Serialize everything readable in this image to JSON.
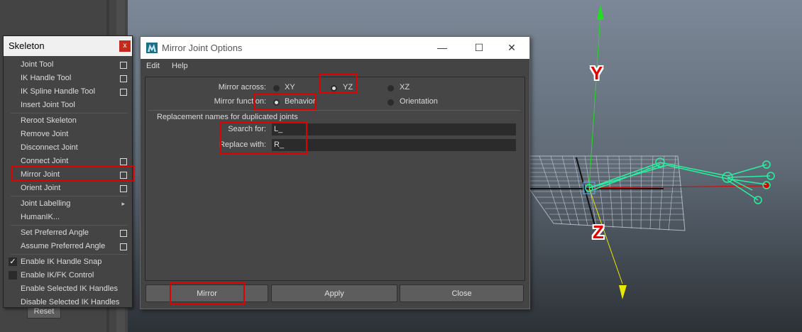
{
  "viewport": {
    "axis_y_label": "Y",
    "axis_z_label": "Z"
  },
  "reset_button": "Reset",
  "skeleton_menu": {
    "title": "Skeleton",
    "close": "x",
    "items": [
      {
        "label": "Joint Tool"
      },
      {
        "label": "IK Handle Tool"
      },
      {
        "label": "IK Spline Handle Tool"
      },
      {
        "label": "Insert Joint Tool"
      },
      {
        "label": "Reroot Skeleton"
      },
      {
        "label": "Remove Joint"
      },
      {
        "label": "Disconnect Joint"
      },
      {
        "label": "Connect Joint"
      },
      {
        "label": "Mirror Joint"
      },
      {
        "label": "Orient Joint"
      },
      {
        "label": "Joint Labelling"
      },
      {
        "label": "HumanIK..."
      },
      {
        "label": "Set Preferred Angle"
      },
      {
        "label": "Assume Preferred Angle"
      },
      {
        "label": "Enable IK Handle Snap",
        "checked": true
      },
      {
        "label": "Enable IK/FK Control",
        "checked": false
      },
      {
        "label": "Enable Selected IK Handles"
      },
      {
        "label": "Disable Selected IK Handles"
      }
    ]
  },
  "dialog": {
    "title": "Mirror Joint Options",
    "menu": [
      "Edit",
      "Help"
    ],
    "mirror_across_label": "Mirror across:",
    "mirror_across_options": [
      "XY",
      "YZ",
      "XZ"
    ],
    "mirror_across_selected": "YZ",
    "mirror_function_label": "Mirror function:",
    "mirror_function_options": [
      "Behavior",
      "Orientation"
    ],
    "mirror_function_selected": "Behavior",
    "replacement_header": "Replacement names for duplicated joints",
    "search_for_label": "Search for:",
    "search_for_value": "L_",
    "replace_with_label": "Replace with:",
    "replace_with_value": "R_",
    "buttons": {
      "mirror": "Mirror",
      "apply": "Apply",
      "close": "Close"
    }
  },
  "colors": {
    "highlight": "#e00000",
    "accent_green": "#22ff99"
  }
}
